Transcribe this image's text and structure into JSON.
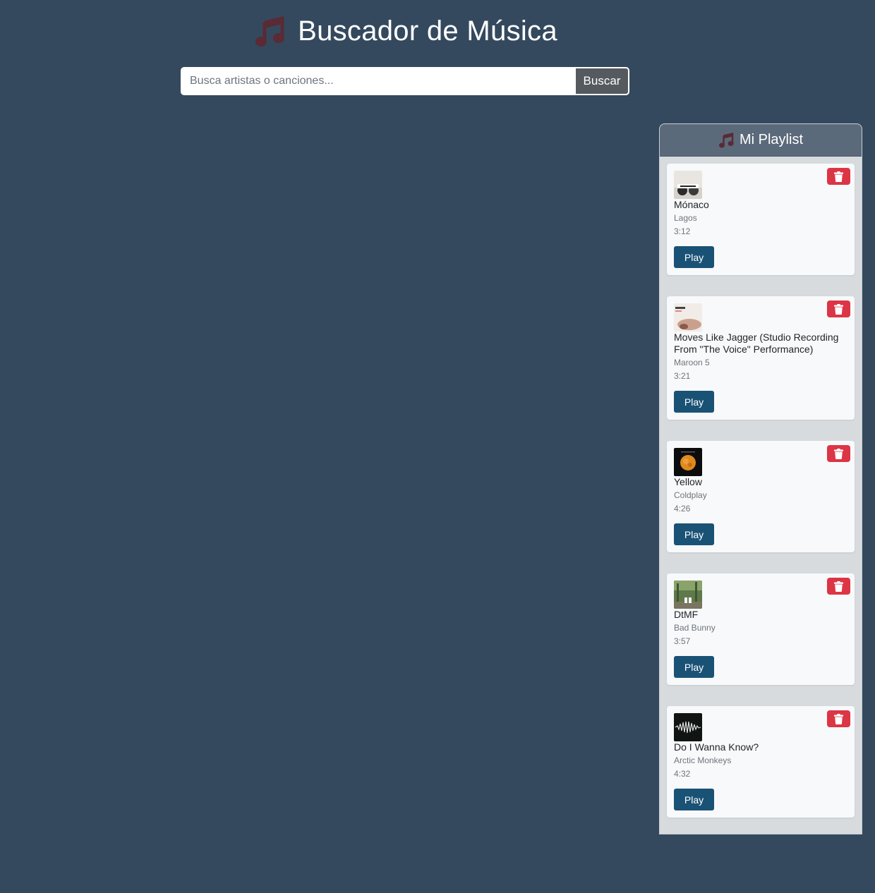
{
  "app": {
    "title": "Buscador de Música",
    "icon": "music-note-icon",
    "accent_icon_color": "#5a2a35"
  },
  "search": {
    "placeholder": "Busca artistas o canciones...",
    "value": "",
    "button_label": "Buscar"
  },
  "playlist": {
    "title": "Mi Playlist",
    "play_label": "Play",
    "delete_icon": "trash-icon",
    "tracks": [
      {
        "title": "Mónaco",
        "artist": "Lagos",
        "duration": "3:12",
        "cover": "album-cover-lagos"
      },
      {
        "title": "Moves Like Jagger (Studio Recording From \"The Voice\" Performance)",
        "artist": "Maroon 5",
        "duration": "3:21",
        "cover": "album-cover-maroon5"
      },
      {
        "title": "Yellow",
        "artist": "Coldplay",
        "duration": "4:26",
        "cover": "album-cover-coldplay"
      },
      {
        "title": "DtMF",
        "artist": "Bad Bunny",
        "duration": "3:57",
        "cover": "album-cover-badbunny"
      },
      {
        "title": "Do I Wanna Know?",
        "artist": "Arctic Monkeys",
        "duration": "4:32",
        "cover": "album-cover-arcticmonkeys"
      }
    ]
  },
  "colors": {
    "background": "#34495e",
    "play_button": "#1a5276",
    "delete_button": "#dc3545",
    "playlist_header": "#5b6a7a"
  }
}
